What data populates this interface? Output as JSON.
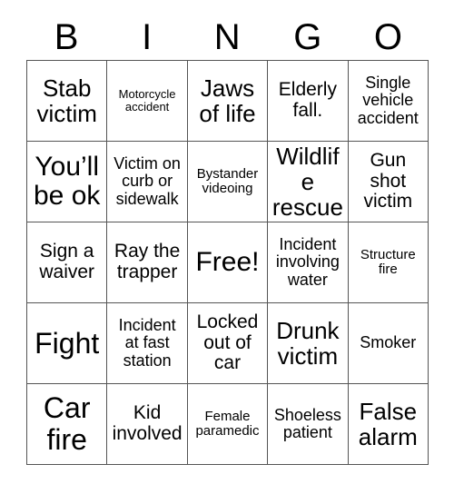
{
  "card": {
    "title": "BINGO",
    "header_letters": [
      "B",
      "I",
      "N",
      "G",
      "O"
    ],
    "columns": 5,
    "rows": 5,
    "colors": {
      "background": "#ffffff",
      "text": "#000000",
      "grid_line": "#555555"
    },
    "cells": [
      {
        "text": "Stab victim",
        "size": "lg",
        "row": 1,
        "col": 1
      },
      {
        "text": "Motorcycle accident",
        "size": "xxs",
        "row": 1,
        "col": 2
      },
      {
        "text": "Jaws of life",
        "size": "lg",
        "row": 1,
        "col": 3
      },
      {
        "text": "Elderly fall.",
        "size": "md",
        "row": 1,
        "col": 4
      },
      {
        "text": "Single vehicle accident",
        "size": "sm",
        "row": 1,
        "col": 5
      },
      {
        "text": "You’ll be ok",
        "size": "xl",
        "row": 2,
        "col": 1
      },
      {
        "text": "Victim on curb or sidewalk",
        "size": "sm",
        "row": 2,
        "col": 2
      },
      {
        "text": "Bystander videoing",
        "size": "xs",
        "row": 2,
        "col": 3
      },
      {
        "text": "Wildlife rescue",
        "size": "lg",
        "row": 2,
        "col": 4
      },
      {
        "text": "Gun shot victim",
        "size": "md",
        "row": 2,
        "col": 5
      },
      {
        "text": "Sign a waiver",
        "size": "md",
        "row": 3,
        "col": 1
      },
      {
        "text": "Ray the trapper",
        "size": "md",
        "row": 3,
        "col": 2
      },
      {
        "text": "Free!",
        "size": "xl",
        "row": 3,
        "col": 3
      },
      {
        "text": "Incident involving water",
        "size": "sm",
        "row": 3,
        "col": 4
      },
      {
        "text": "Structure fire",
        "size": "xs",
        "row": 3,
        "col": 5
      },
      {
        "text": "Fight",
        "size": "xxl",
        "row": 4,
        "col": 1
      },
      {
        "text": "Incident at fast station",
        "size": "sm",
        "row": 4,
        "col": 2
      },
      {
        "text": "Locked out of car",
        "size": "md",
        "row": 4,
        "col": 3
      },
      {
        "text": "Drunk victim",
        "size": "lg",
        "row": 4,
        "col": 4
      },
      {
        "text": "Smoker",
        "size": "sm",
        "row": 4,
        "col": 5
      },
      {
        "text": "Car fire",
        "size": "xxl",
        "row": 5,
        "col": 1
      },
      {
        "text": "Kid involved",
        "size": "md",
        "row": 5,
        "col": 2
      },
      {
        "text": "Female paramedic",
        "size": "xs",
        "row": 5,
        "col": 3
      },
      {
        "text": "Shoeless patient",
        "size": "sm",
        "row": 5,
        "col": 4
      },
      {
        "text": "False alarm",
        "size": "lg",
        "row": 5,
        "col": 5
      }
    ]
  }
}
